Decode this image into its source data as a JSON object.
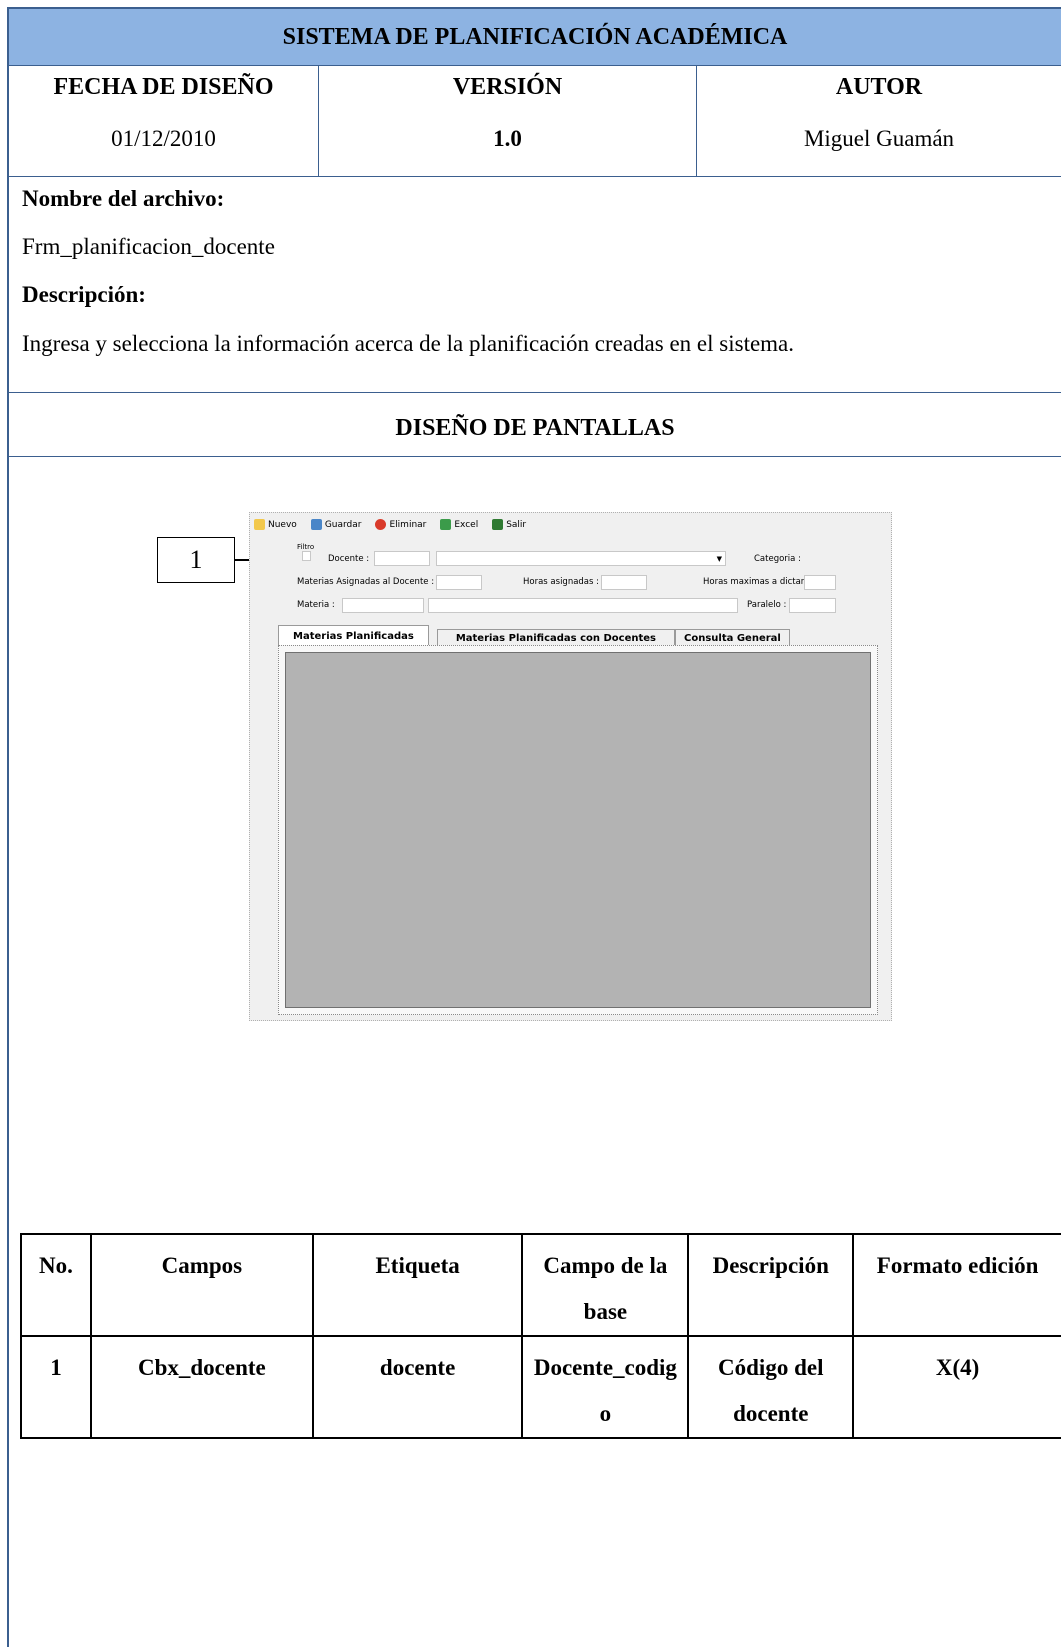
{
  "header": {
    "title": "SISTEMA DE PLANIFICACIÓN ACADÉMICA",
    "fecha_label": "FECHA DE DISEÑO",
    "fecha_value": "01/12/2010",
    "version_label": "VERSIÓN",
    "version_value": "1.0",
    "autor_label": "AUTOR",
    "autor_value": "Miguel Guamán"
  },
  "info": {
    "archivo_label": "Nombre del archivo:",
    "archivo_value": "Frm_planificacion_docente",
    "descripcion_label": "Descripción:",
    "descripcion_value": "Ingresa y selecciona la información acerca de la planificación creadas en el sistema."
  },
  "section_title": "DISEÑO DE PANTALLAS",
  "callout_number": "1",
  "app": {
    "toolbar": [
      "Nuevo",
      "Guardar",
      "Eliminar",
      "Excel",
      "Salir"
    ],
    "filtro_label": "Filtro",
    "docente_label": "Docente :",
    "categoria_label": "Categoria :",
    "materias_asignadas_label": "Materias Asignadas al Docente :",
    "horas_asignadas_label": "Horas asignadas :",
    "horas_maximas_label": "Horas maximas a dictar :",
    "materia_label": "Materia :",
    "paralelo_label": "Paralelo :",
    "tabs": [
      "Materias Planificadas",
      "Materias Planificadas con Docentes",
      "Consulta General"
    ]
  },
  "fields_table": {
    "headers": [
      "No.",
      "Campos",
      "Etiqueta",
      "Campo de la base",
      "Descripción",
      "Formato edición"
    ],
    "rows": [
      [
        "1",
        "Cbx_docente",
        "docente",
        "Docente_codigo",
        "Código del docente",
        "X(4)"
      ]
    ]
  }
}
